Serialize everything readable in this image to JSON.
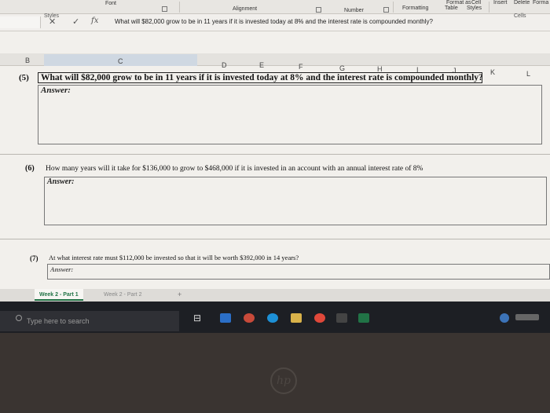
{
  "ribbon": {
    "font_group": "Font",
    "alignment_group": "Alignment",
    "number_group": "Number",
    "styles": {
      "format_as": "Format as",
      "cell": "Cell",
      "formatting": "Formatting",
      "table": "Table",
      "styles_btn": "Styles",
      "group_label": "Styles"
    },
    "cells": {
      "insert": "Insert",
      "delete": "Delete",
      "format": "Forma",
      "group_label": "Cells"
    }
  },
  "formula_bar": {
    "cancel_symbol": "✕",
    "enter_symbol": "✓",
    "fx": "fx",
    "content": "What will $82,000 grow to be in 11 years if it is invested today at 8% and the interest rate is compounded monthly?"
  },
  "columns": [
    "B",
    "C",
    "D",
    "E",
    "F",
    "G",
    "H",
    "I",
    "J",
    "K",
    "L"
  ],
  "questions": [
    {
      "number": "(5)",
      "text": "What will $82,000 grow to be in 11 years if it is invested today at 8% and the interest rate is compounded monthly?",
      "answer_label": "Answer:"
    },
    {
      "number": "(6)",
      "text": "How many years will it take for $136,000 to grow to $468,000 if it is invested in an account with an annual interest rate of 8%",
      "answer_label": "Answer:"
    },
    {
      "number": "(7)",
      "text": "At what interest rate must $112,000 be invested so that it will be worth $392,000 in 14 years?",
      "answer_label": "Answer:"
    }
  ],
  "sheet_tabs": [
    {
      "label": "Week 2 - Part 1",
      "active": true
    },
    {
      "label": "Week 2 - Part 2",
      "active": false
    }
  ],
  "add_sheet_symbol": "+",
  "taskbar": {
    "search_placeholder": "Type here to search",
    "task_view_symbol": "⊟"
  },
  "colors": {
    "accent_excel": "#217346",
    "taskbar": "#1d1f24"
  }
}
